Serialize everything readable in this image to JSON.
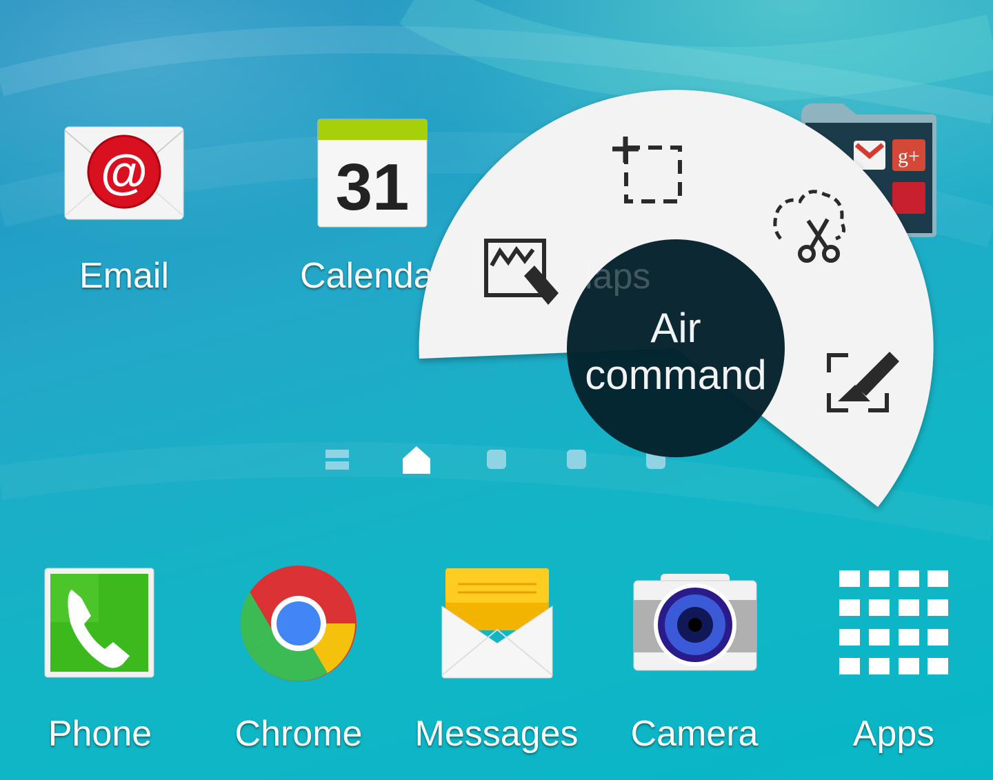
{
  "home": {
    "apps": [
      {
        "label": "Email",
        "icon": "email-icon"
      },
      {
        "label": "Calenda",
        "icon": "calendar-icon",
        "day": "31"
      },
      {
        "label": "Maps",
        "partial_label": "laps",
        "icon": "maps-icon"
      }
    ],
    "folder": {
      "icon": "folder-icon"
    }
  },
  "page_indicator": {
    "icons": [
      "list-icon",
      "home-icon",
      "page-dot",
      "page-dot",
      "page-dot"
    ],
    "current": "home"
  },
  "dock": {
    "apps": [
      {
        "label": "Phone",
        "icon": "phone-icon"
      },
      {
        "label": "Chrome",
        "icon": "chrome-icon"
      },
      {
        "label": "Messages",
        "icon": "messages-icon"
      },
      {
        "label": "Camera",
        "icon": "camera-icon"
      },
      {
        "label": "Apps",
        "icon": "apps-grid-icon"
      }
    ]
  },
  "air_command": {
    "title_line1": "Air",
    "title_line2": "command",
    "actions": [
      {
        "name": "action-memo",
        "icon": "action-memo-icon"
      },
      {
        "name": "smart-select",
        "icon": "smart-select-icon"
      },
      {
        "name": "image-clip",
        "icon": "image-clip-icon"
      },
      {
        "name": "screen-write",
        "icon": "screen-write-icon"
      }
    ],
    "colors": {
      "menu": "#f3f3f3",
      "center": "#04222c"
    }
  },
  "colors": {
    "wallpaper": "#1ea9c8",
    "icon_text": "#ffffff"
  }
}
